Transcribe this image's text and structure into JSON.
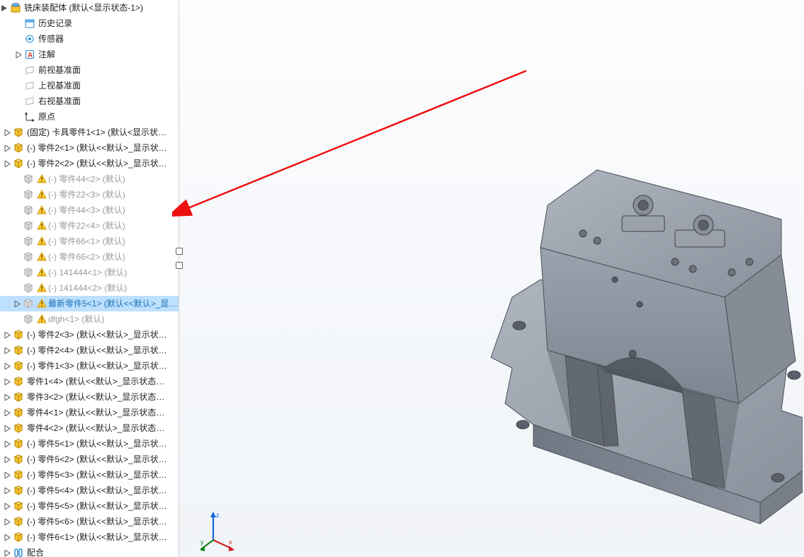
{
  "assembly_title": "铣床装配体  (默认<显示状态-1>)",
  "top_items": [
    {
      "icon": "history",
      "label": "历史记录"
    },
    {
      "icon": "sensor",
      "label": "传感器"
    },
    {
      "icon": "annot",
      "label": "注解"
    },
    {
      "icon": "plane",
      "label": "前视基准面"
    },
    {
      "icon": "plane",
      "label": "上视基准面"
    },
    {
      "icon": "plane",
      "label": "右视基准面"
    },
    {
      "icon": "origin",
      "label": "原点"
    }
  ],
  "components": [
    {
      "tg": true,
      "ic": "part-y",
      "label": "(固定) 卡具零件1<1> (默认<显示状…"
    },
    {
      "tg": true,
      "ic": "part-y",
      "label": "(-) 零件2<1> (默认<<默认>_显示状…"
    },
    {
      "tg": true,
      "ic": "part-y",
      "label": "(-) 零件2<2> (默认<<默认>_显示状…"
    },
    {
      "tg": false,
      "ic": "part-g",
      "warn": true,
      "dim": true,
      "label": "(-) 零件44<2> (默认)"
    },
    {
      "tg": false,
      "ic": "part-g",
      "warn": true,
      "dim": true,
      "label": "(-) 零件22<3> (默认)"
    },
    {
      "tg": false,
      "ic": "part-g",
      "warn": true,
      "dim": true,
      "label": "(-) 零件44<3> (默认)"
    },
    {
      "tg": false,
      "ic": "part-g",
      "warn": true,
      "dim": true,
      "label": "(-) 零件22<4> (默认)"
    },
    {
      "tg": false,
      "ic": "part-g",
      "warn": true,
      "dim": true,
      "label": "(-) 零件66<1> (默认)"
    },
    {
      "tg": false,
      "ic": "part-g",
      "warn": true,
      "dim": true,
      "label": "(-) 零件66<2> (默认)"
    },
    {
      "tg": false,
      "ic": "part-g",
      "warn": true,
      "dim": true,
      "label": "(-) 141444<1> (默认)"
    },
    {
      "tg": false,
      "ic": "part-g",
      "warn": true,
      "dim": true,
      "label": "(-) 141444<2> (默认)"
    },
    {
      "tg": true,
      "ic": "part-g",
      "warn": true,
      "sel": true,
      "label": "最新零件5<1> (默认<<默认>_显…"
    },
    {
      "tg": false,
      "ic": "part-g",
      "warn": true,
      "dim": true,
      "label": "dfgh<1> (默认)"
    },
    {
      "tg": true,
      "ic": "part-y",
      "label": "(-) 零件2<3> (默认<<默认>_显示状…"
    },
    {
      "tg": true,
      "ic": "part-y",
      "label": "(-) 零件2<4> (默认<<默认>_显示状…"
    },
    {
      "tg": true,
      "ic": "part-y",
      "label": "(-) 零件1<3> (默认<<默认>_显示状…"
    },
    {
      "tg": true,
      "ic": "part-y",
      "label": "零件1<4> (默认<<默认>_显示状态…"
    },
    {
      "tg": true,
      "ic": "part-y",
      "label": "零件3<2> (默认<<默认>_显示状态…"
    },
    {
      "tg": true,
      "ic": "part-y",
      "label": "零件4<1> (默认<<默认>_显示状态…"
    },
    {
      "tg": true,
      "ic": "part-y",
      "label": "零件4<2> (默认<<默认>_显示状态…"
    },
    {
      "tg": true,
      "ic": "part-y",
      "label": "(-) 零件5<1> (默认<<默认>_显示状…"
    },
    {
      "tg": true,
      "ic": "part-y",
      "label": "(-) 零件5<2> (默认<<默认>_显示状…"
    },
    {
      "tg": true,
      "ic": "part-y",
      "label": "(-) 零件5<3> (默认<<默认>_显示状…"
    },
    {
      "tg": true,
      "ic": "part-y",
      "label": "(-) 零件5<4> (默认<<默认>_显示状…"
    },
    {
      "tg": true,
      "ic": "part-y",
      "label": "(-) 零件5<5> (默认<<默认>_显示状…"
    },
    {
      "tg": true,
      "ic": "part-y",
      "label": "(-) 零件5<6> (默认<<默认>_显示状…"
    },
    {
      "tg": true,
      "ic": "part-y",
      "label": "(-) 零件6<1> (默认<<默认>_显示状…"
    }
  ],
  "mates_label": "配合",
  "axis_labels": {
    "x": "x",
    "y": "y",
    "z": "z"
  }
}
